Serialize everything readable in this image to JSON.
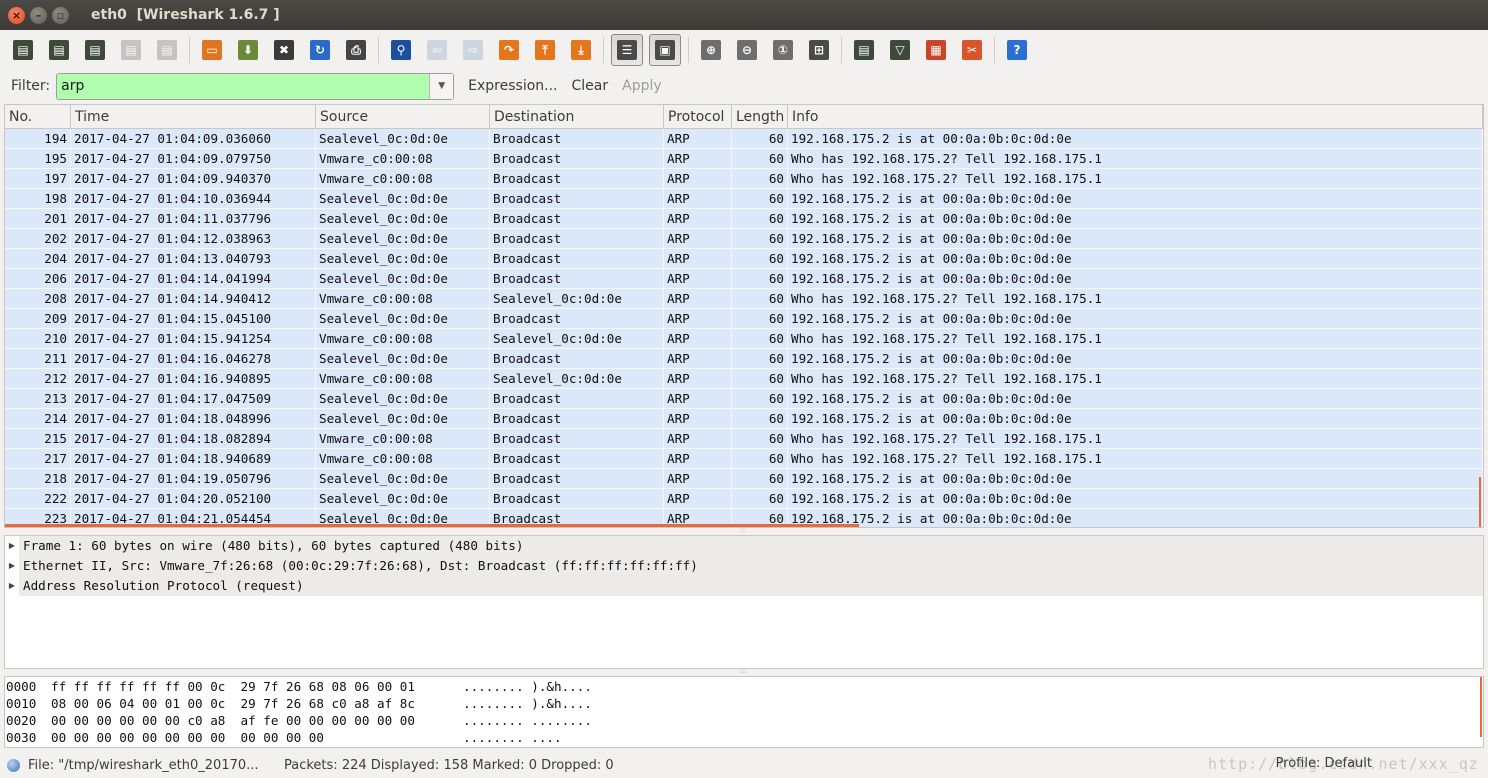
{
  "window": {
    "title": "eth0  [Wireshark 1.6.7 ]",
    "close_glyph": "×",
    "min_glyph": "–",
    "max_glyph": "▫"
  },
  "toolbar": {
    "buttons": [
      {
        "name": "interface-list-icon",
        "glyph": "▤",
        "color": "#3d4a3a",
        "disabled": false
      },
      {
        "name": "capture-options-icon",
        "glyph": "▤",
        "color": "#3d4a3a",
        "disabled": false
      },
      {
        "name": "start-capture-icon",
        "glyph": "▤",
        "color": "#3d4a3a",
        "disabled": false
      },
      {
        "name": "stop-capture-icon",
        "glyph": "▤",
        "color": "#7d7d7d",
        "disabled": true
      },
      {
        "name": "restart-capture-icon",
        "glyph": "▤",
        "color": "#7d7d7d",
        "disabled": true
      },
      {
        "name": "open-file-icon",
        "glyph": "▭",
        "color": "#e0751f",
        "disabled": false
      },
      {
        "name": "save-file-icon",
        "glyph": "⬇",
        "color": "#6a8a3a",
        "disabled": false
      },
      {
        "name": "close-file-icon",
        "glyph": "✖",
        "color": "#3a3a3a",
        "disabled": false
      },
      {
        "name": "reload-icon",
        "glyph": "↻",
        "color": "#2a6bc9",
        "disabled": false
      },
      {
        "name": "print-icon",
        "glyph": "⎙",
        "color": "#444444",
        "disabled": false
      },
      {
        "name": "find-packet-icon",
        "glyph": "⚲",
        "color": "#1e4f9c",
        "disabled": false
      },
      {
        "name": "go-back-icon",
        "glyph": "⇦",
        "color": "#8fa8c8",
        "disabled": true
      },
      {
        "name": "go-forward-icon",
        "glyph": "⇨",
        "color": "#8fa8c8",
        "disabled": true
      },
      {
        "name": "go-to-packet-icon",
        "glyph": "↷",
        "color": "#e6761c",
        "disabled": false
      },
      {
        "name": "go-first-packet-icon",
        "glyph": "⤒",
        "color": "#e6761c",
        "disabled": false
      },
      {
        "name": "go-last-packet-icon",
        "glyph": "⤓",
        "color": "#e6761c",
        "disabled": false
      },
      {
        "name": "colorize-icon",
        "glyph": "☰",
        "color": "#4a4a4a",
        "disabled": false,
        "pressed": true
      },
      {
        "name": "auto-scroll-icon",
        "glyph": "▣",
        "color": "#4a4a4a",
        "disabled": false,
        "pressed": true
      },
      {
        "name": "zoom-in-icon",
        "glyph": "⊕",
        "color": "#6e6e6e",
        "disabled": false
      },
      {
        "name": "zoom-out-icon",
        "glyph": "⊖",
        "color": "#6e6e6e",
        "disabled": false
      },
      {
        "name": "normal-size-icon",
        "glyph": "①",
        "color": "#6e6e6e",
        "disabled": false
      },
      {
        "name": "resize-columns-icon",
        "glyph": "⊞",
        "color": "#4a4a4a",
        "disabled": false
      },
      {
        "name": "capture-filters-icon",
        "glyph": "▤",
        "color": "#3d4a3a",
        "disabled": false
      },
      {
        "name": "display-filters-icon",
        "glyph": "▽",
        "color": "#3d4a3a",
        "disabled": false
      },
      {
        "name": "coloring-rules-icon",
        "glyph": "▦",
        "color": "#c9452a",
        "disabled": false
      },
      {
        "name": "preferences-icon",
        "glyph": "✂",
        "color": "#d9542a",
        "disabled": false
      },
      {
        "name": "help-icon",
        "glyph": "?",
        "color": "#2b6fd6",
        "disabled": false
      }
    ]
  },
  "filter": {
    "label": "Filter:",
    "value": "arp",
    "dropdown_glyph": "▼",
    "expression_label": "Expression...",
    "clear_label": "Clear",
    "apply_label": "Apply"
  },
  "packet_list": {
    "columns": [
      {
        "key": "no",
        "label": "No."
      },
      {
        "key": "time",
        "label": "Time"
      },
      {
        "key": "source",
        "label": "Source"
      },
      {
        "key": "destination",
        "label": "Destination"
      },
      {
        "key": "protocol",
        "label": "Protocol"
      },
      {
        "key": "length",
        "label": "Length"
      },
      {
        "key": "info",
        "label": "Info"
      }
    ],
    "rows": [
      {
        "no": "194",
        "time": "2017-04-27 01:04:09.036060",
        "source": "Sealevel_0c:0d:0e",
        "destination": "Broadcast",
        "protocol": "ARP",
        "length": "60",
        "info": "192.168.175.2 is at 00:0a:0b:0c:0d:0e"
      },
      {
        "no": "195",
        "time": "2017-04-27 01:04:09.079750",
        "source": "Vmware_c0:00:08",
        "destination": "Broadcast",
        "protocol": "ARP",
        "length": "60",
        "info": "Who has 192.168.175.2?  Tell 192.168.175.1"
      },
      {
        "no": "197",
        "time": "2017-04-27 01:04:09.940370",
        "source": "Vmware_c0:00:08",
        "destination": "Broadcast",
        "protocol": "ARP",
        "length": "60",
        "info": "Who has 192.168.175.2?  Tell 192.168.175.1"
      },
      {
        "no": "198",
        "time": "2017-04-27 01:04:10.036944",
        "source": "Sealevel_0c:0d:0e",
        "destination": "Broadcast",
        "protocol": "ARP",
        "length": "60",
        "info": "192.168.175.2 is at 00:0a:0b:0c:0d:0e"
      },
      {
        "no": "201",
        "time": "2017-04-27 01:04:11.037796",
        "source": "Sealevel_0c:0d:0e",
        "destination": "Broadcast",
        "protocol": "ARP",
        "length": "60",
        "info": "192.168.175.2 is at 00:0a:0b:0c:0d:0e"
      },
      {
        "no": "202",
        "time": "2017-04-27 01:04:12.038963",
        "source": "Sealevel_0c:0d:0e",
        "destination": "Broadcast",
        "protocol": "ARP",
        "length": "60",
        "info": "192.168.175.2 is at 00:0a:0b:0c:0d:0e"
      },
      {
        "no": "204",
        "time": "2017-04-27 01:04:13.040793",
        "source": "Sealevel_0c:0d:0e",
        "destination": "Broadcast",
        "protocol": "ARP",
        "length": "60",
        "info": "192.168.175.2 is at 00:0a:0b:0c:0d:0e"
      },
      {
        "no": "206",
        "time": "2017-04-27 01:04:14.041994",
        "source": "Sealevel_0c:0d:0e",
        "destination": "Broadcast",
        "protocol": "ARP",
        "length": "60",
        "info": "192.168.175.2 is at 00:0a:0b:0c:0d:0e"
      },
      {
        "no": "208",
        "time": "2017-04-27 01:04:14.940412",
        "source": "Vmware_c0:00:08",
        "destination": "Sealevel_0c:0d:0e",
        "protocol": "ARP",
        "length": "60",
        "info": "Who has 192.168.175.2?  Tell 192.168.175.1"
      },
      {
        "no": "209",
        "time": "2017-04-27 01:04:15.045100",
        "source": "Sealevel_0c:0d:0e",
        "destination": "Broadcast",
        "protocol": "ARP",
        "length": "60",
        "info": "192.168.175.2 is at 00:0a:0b:0c:0d:0e"
      },
      {
        "no": "210",
        "time": "2017-04-27 01:04:15.941254",
        "source": "Vmware_c0:00:08",
        "destination": "Sealevel_0c:0d:0e",
        "protocol": "ARP",
        "length": "60",
        "info": "Who has 192.168.175.2?  Tell 192.168.175.1"
      },
      {
        "no": "211",
        "time": "2017-04-27 01:04:16.046278",
        "source": "Sealevel_0c:0d:0e",
        "destination": "Broadcast",
        "protocol": "ARP",
        "length": "60",
        "info": "192.168.175.2 is at 00:0a:0b:0c:0d:0e"
      },
      {
        "no": "212",
        "time": "2017-04-27 01:04:16.940895",
        "source": "Vmware_c0:00:08",
        "destination": "Sealevel_0c:0d:0e",
        "protocol": "ARP",
        "length": "60",
        "info": "Who has 192.168.175.2?  Tell 192.168.175.1"
      },
      {
        "no": "213",
        "time": "2017-04-27 01:04:17.047509",
        "source": "Sealevel_0c:0d:0e",
        "destination": "Broadcast",
        "protocol": "ARP",
        "length": "60",
        "info": "192.168.175.2 is at 00:0a:0b:0c:0d:0e"
      },
      {
        "no": "214",
        "time": "2017-04-27 01:04:18.048996",
        "source": "Sealevel_0c:0d:0e",
        "destination": "Broadcast",
        "protocol": "ARP",
        "length": "60",
        "info": "192.168.175.2 is at 00:0a:0b:0c:0d:0e"
      },
      {
        "no": "215",
        "time": "2017-04-27 01:04:18.082894",
        "source": "Vmware_c0:00:08",
        "destination": "Broadcast",
        "protocol": "ARP",
        "length": "60",
        "info": "Who has 192.168.175.2?  Tell 192.168.175.1"
      },
      {
        "no": "217",
        "time": "2017-04-27 01:04:18.940689",
        "source": "Vmware_c0:00:08",
        "destination": "Broadcast",
        "protocol": "ARP",
        "length": "60",
        "info": "Who has 192.168.175.2?  Tell 192.168.175.1"
      },
      {
        "no": "218",
        "time": "2017-04-27 01:04:19.050796",
        "source": "Sealevel_0c:0d:0e",
        "destination": "Broadcast",
        "protocol": "ARP",
        "length": "60",
        "info": "192.168.175.2 is at 00:0a:0b:0c:0d:0e"
      },
      {
        "no": "222",
        "time": "2017-04-27 01:04:20.052100",
        "source": "Sealevel_0c:0d:0e",
        "destination": "Broadcast",
        "protocol": "ARP",
        "length": "60",
        "info": "192.168.175.2 is at 00:0a:0b:0c:0d:0e"
      },
      {
        "no": "223",
        "time": "2017-04-27 01:04:21.054454",
        "source": "Sealevel_0c:0d:0e",
        "destination": "Broadcast",
        "protocol": "ARP",
        "length": "60",
        "info": "192.168.175.2 is at 00:0a:0b:0c:0d:0e"
      }
    ],
    "row_color": "#dae8fa"
  },
  "details": {
    "expander_glyph": "▶",
    "items": [
      "Frame 1: 60 bytes on wire (480 bits), 60 bytes captured (480 bits)",
      "Ethernet II, Src: Vmware_7f:26:68 (00:0c:29:7f:26:68), Dst: Broadcast (ff:ff:ff:ff:ff:ff)",
      "Address Resolution Protocol (request)"
    ]
  },
  "hex": {
    "rows": [
      {
        "offset": "0000",
        "bytes": "ff ff ff ff ff ff 00 0c  29 7f 26 68 08 06 00 01",
        "ascii": "........ ).&h...."
      },
      {
        "offset": "0010",
        "bytes": "08 00 06 04 00 01 00 0c  29 7f 26 68 c0 a8 af 8c",
        "ascii": "........ ).&h...."
      },
      {
        "offset": "0020",
        "bytes": "00 00 00 00 00 00 c0 a8  af fe 00 00 00 00 00 00",
        "ascii": "........ ........"
      },
      {
        "offset": "0030",
        "bytes": "00 00 00 00 00 00 00 00  00 00 00 00",
        "ascii": "........ ...."
      }
    ]
  },
  "status": {
    "file": "File: \"/tmp/wireshark_eth0_20170...",
    "packets": "Packets: 224 Displayed: 158 Marked: 0 Dropped: 0",
    "profile": "Profile: Default",
    "watermark": "http://blog.csdn.net/xxx_qz"
  },
  "colors": {
    "accent": "#e7693c",
    "filter_valid": "#afffaf"
  }
}
